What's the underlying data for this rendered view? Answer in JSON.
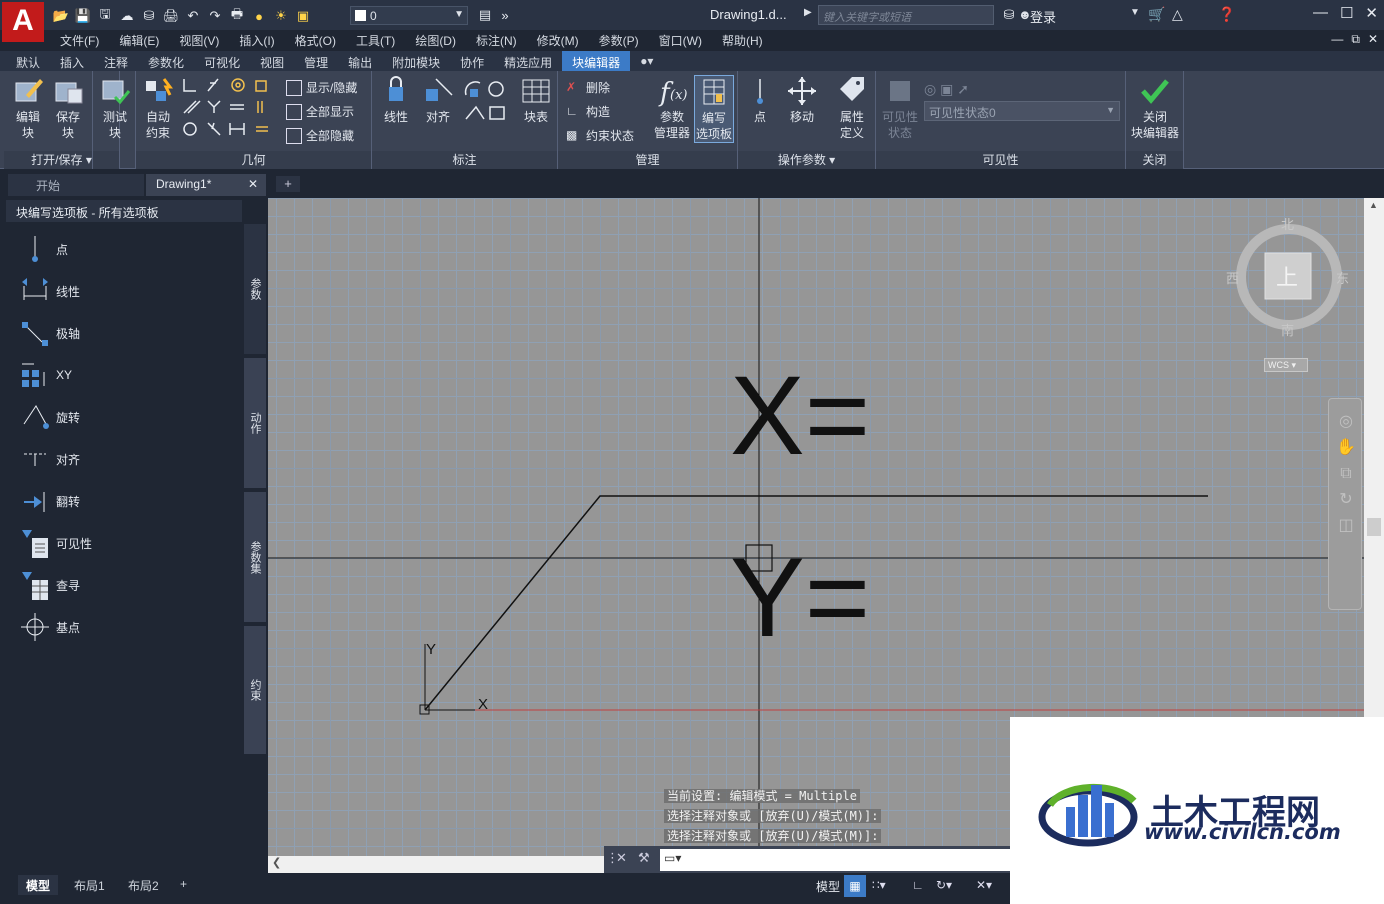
{
  "app": {
    "logo_letter": "A",
    "document_title": "Drawing1.d...",
    "search_placeholder": "键入关键字或短语",
    "login_label": "登录",
    "layer_value": "0"
  },
  "menu": [
    "文件(F)",
    "编辑(E)",
    "视图(V)",
    "插入(I)",
    "格式(O)",
    "工具(T)",
    "绘图(D)",
    "标注(N)",
    "修改(M)",
    "参数(P)",
    "窗口(W)",
    "帮助(H)"
  ],
  "ribbon_tabs": [
    "默认",
    "插入",
    "注释",
    "参数化",
    "可视化",
    "视图",
    "管理",
    "输出",
    "附加模块",
    "协作",
    "精选应用",
    "块编辑器"
  ],
  "active_ribbon_tab": "块编辑器",
  "ribbon": {
    "open_save": {
      "title": "打开/保存",
      "edit_block": "编辑\n块",
      "save_block": "保存\n块"
    },
    "test_block": "测试\n块",
    "geometry": {
      "title": "几何",
      "auto_constrain": "自动\n约束",
      "show_hide": "显示/隐藏",
      "show_all": "全部显示",
      "hide_all": "全部隐藏"
    },
    "dimension": {
      "title": "标注",
      "linear": "线性",
      "aligned": "对齐"
    },
    "manage": {
      "title": "管理",
      "delete": "删除",
      "construction": "构造",
      "constraint_state": "约束状态",
      "block_table": "块表",
      "param_manager": "参数\n管理器",
      "authoring_palette": "编写\n选项板"
    },
    "action_params": {
      "title": "操作参数",
      "point": "点",
      "move": "移动",
      "attribute_def": "属性\n定义"
    },
    "visibility": {
      "title": "可见性",
      "vis_state": "可见性\n状态",
      "vis_state_select": "可见性状态0"
    },
    "close": {
      "title": "关闭",
      "close_editor": "关闭\n块编辑器"
    }
  },
  "file_tabs": {
    "start": "开始",
    "drawing": "Drawing1*"
  },
  "palette": {
    "title": "块编写选项板 - 所有选项板",
    "items": [
      "点",
      "线性",
      "极轴",
      "XY",
      "旋转",
      "对齐",
      "翻转",
      "可见性",
      "查寻",
      "基点"
    ],
    "side_tabs": [
      "参数",
      "动作",
      "参数集",
      "约束"
    ]
  },
  "canvas": {
    "x_label": "X=",
    "y_label": "Y=",
    "ucs_x": "X",
    "ucs_y": "Y"
  },
  "viewcube": {
    "north": "北",
    "south": "南",
    "east": "东",
    "west": "西",
    "top": "上",
    "wcs": "WCS"
  },
  "command": {
    "history": [
      "当前设置: 编辑模式 = Multiple",
      "选择注释对象或 [放弃(U)/模式(M)]:",
      "选择注释对象或 [放弃(U)/模式(M)]:"
    ],
    "input_value": ""
  },
  "layout_tabs": [
    "模型",
    "布局1",
    "布局2"
  ],
  "status": {
    "model_label": "模型"
  },
  "watermark": {
    "cn": "土木工程网",
    "url": "www.civilcn.com"
  },
  "colors": {
    "accent": "#3c7bc7",
    "canvas_bg": "#969696",
    "logo_red": "#c21b1b",
    "wm_blue": "#1c2c5e",
    "wm_green": "#5fb12b"
  }
}
